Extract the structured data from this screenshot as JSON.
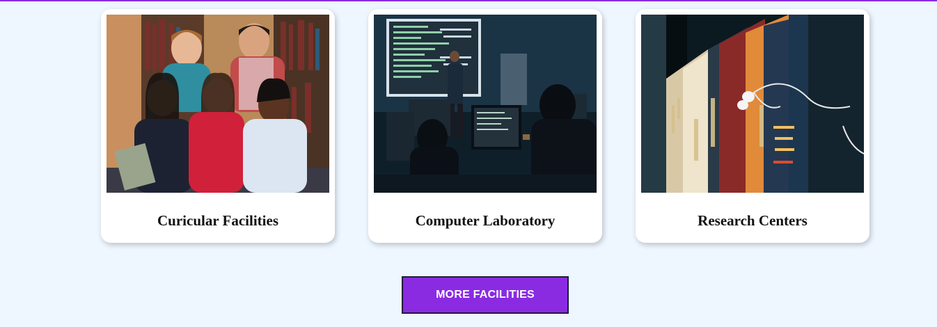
{
  "colors": {
    "accent": "#8a2be2",
    "background": "#eef6ff",
    "card": "#ffffff"
  },
  "facilities": [
    {
      "title": "Curicular Facilities",
      "image": "students-group-photo"
    },
    {
      "title": "Computer Laboratory",
      "image": "computer-lab-photo"
    },
    {
      "title": "Research Centers",
      "image": "books-earphones-photo"
    }
  ],
  "more_button": {
    "label": "MORE FACILITIES"
  }
}
